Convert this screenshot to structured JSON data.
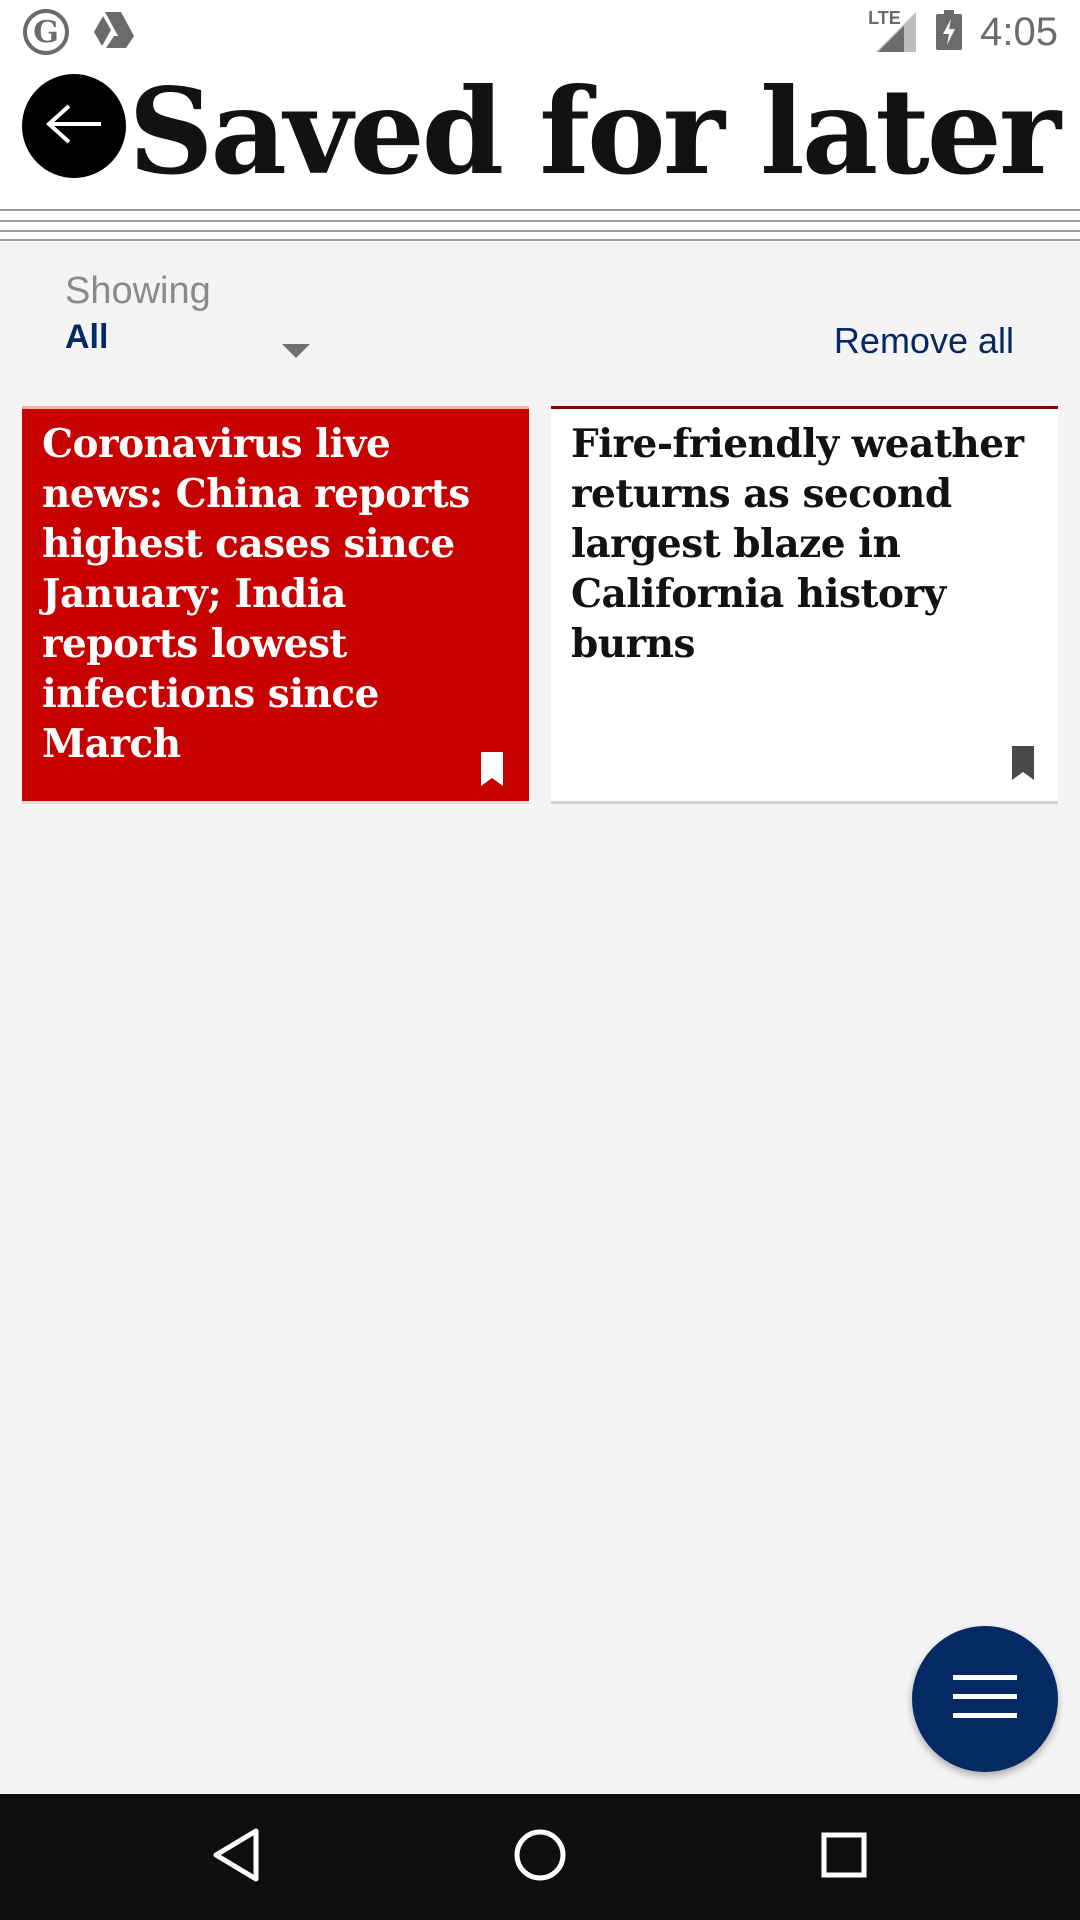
{
  "status_bar": {
    "time": "4:05",
    "network": "LTE",
    "icons": [
      "guardian-logo-icon",
      "drive-icon",
      "signal-icon",
      "battery-icon"
    ]
  },
  "header": {
    "title": "Saved for later",
    "back_icon": "arrow-left-icon"
  },
  "filter": {
    "label": "Showing",
    "value": "All",
    "remove_all": "Remove all"
  },
  "cards": [
    {
      "headline": "Coronavirus live news: China reports highest cases since January; India reports lowest infections since March",
      "background": "#c70000",
      "icon": "bookmark-icon"
    },
    {
      "headline": "Fire-friendly weather returns as second largest blaze in California history burns",
      "background": "#ffffff",
      "icon": "bookmark-icon"
    }
  ],
  "fab": {
    "icon": "menu-icon"
  },
  "nav": {
    "icons": [
      "back-triangle-icon",
      "home-circle-icon",
      "recents-square-icon"
    ]
  },
  "colors": {
    "brand_navy": "#052962",
    "live_red": "#c70000",
    "background": "#f4f4f5"
  }
}
